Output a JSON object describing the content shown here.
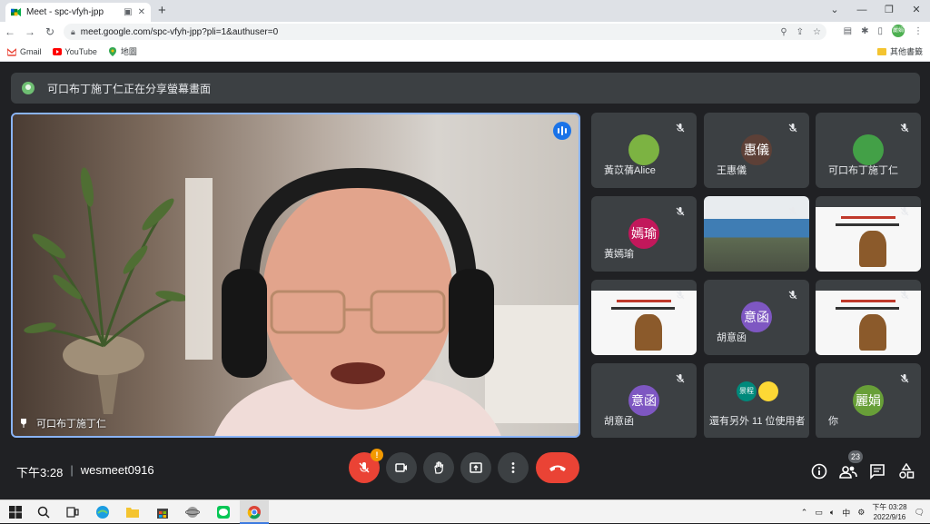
{
  "browser": {
    "tab_title": "Meet - spc-vfyh-jpp",
    "url": "meet.google.com/spc-vfyh-jpp?pli=1&authuser=0",
    "profile_label": "麗娟",
    "bookmarks": [
      "Gmail",
      "YouTube",
      "地圖"
    ],
    "other_bookmarks": "其他書籤"
  },
  "meet": {
    "presenting_banner": "可口布丁施丁仁正在分享螢幕畫面",
    "main_speaker": "可口布丁施丁仁",
    "tiles": [
      {
        "name": "黃苡蒨Alice",
        "kind": "avatar",
        "avatar_text": "",
        "avatar_color": "#7cb342"
      },
      {
        "name": "王惠儀",
        "kind": "avatar",
        "avatar_text": "惠儀",
        "avatar_color": "#5d4037"
      },
      {
        "name": "可口布丁施丁仁",
        "kind": "avatar",
        "avatar_text": "",
        "avatar_color": "#43a047"
      },
      {
        "name": "黃嫣瑜",
        "kind": "avatar",
        "avatar_text": "嫣瑜",
        "avatar_color": "#c2185b"
      },
      {
        "name": "",
        "kind": "classroom",
        "avatar_text": "",
        "avatar_color": ""
      },
      {
        "name": "",
        "kind": "screen",
        "avatar_text": "",
        "avatar_color": ""
      },
      {
        "name": "",
        "kind": "screen",
        "avatar_text": "",
        "avatar_color": ""
      },
      {
        "name": "胡意函",
        "kind": "avatar",
        "avatar_text": "意函",
        "avatar_color": "#7e57c2"
      },
      {
        "name": "",
        "kind": "screen",
        "avatar_text": "",
        "avatar_color": ""
      },
      {
        "name": "胡意函",
        "kind": "avatar",
        "avatar_text": "意函",
        "avatar_color": "#7e57c2"
      },
      {
        "name": "還有另外 11 位使用者",
        "kind": "others",
        "avatar_text": "景程",
        "avatar_color": "#00897b"
      },
      {
        "name": "你",
        "kind": "avatar",
        "avatar_text": "麗娟",
        "avatar_color": "#689f38"
      }
    ],
    "time": "下午3:28",
    "meeting_code": "wesmeet0916",
    "mic_badge": "!",
    "participant_count": "23"
  },
  "taskbar": {
    "time": "下午 03:28",
    "date": "2022/9/16",
    "ime": "中"
  }
}
